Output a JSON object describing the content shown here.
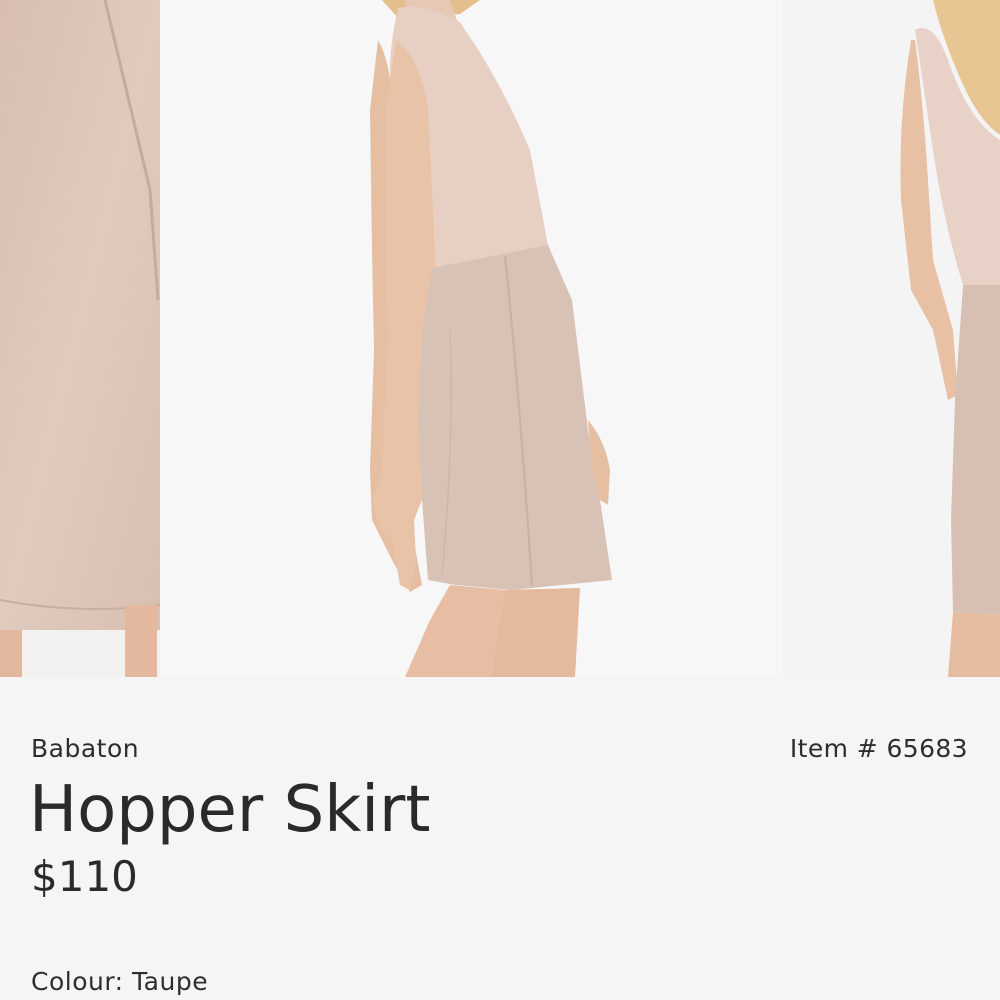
{
  "product": {
    "brand": "Babaton",
    "item_number": "Item # 65683",
    "name": "Hopper Skirt",
    "price": "$110",
    "colour": "Colour: Taupe"
  },
  "gallery": {
    "slides": [
      {
        "id": "detail-closeup",
        "active": false
      },
      {
        "id": "side-view",
        "active": true
      },
      {
        "id": "back-view",
        "active": false
      }
    ],
    "colors": {
      "skirt": "#d9c2b5",
      "top": "#e7cfc3",
      "skin": "#e9c2a6",
      "hair": "#e6c08f",
      "background": "#f7f7f8"
    }
  }
}
